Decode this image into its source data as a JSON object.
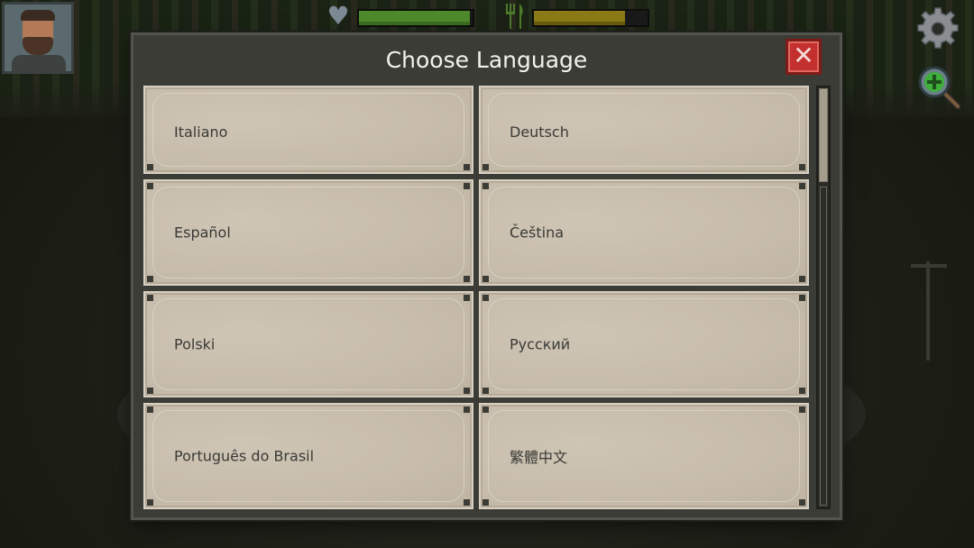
{
  "dialog": {
    "title": "Choose Language",
    "close_label": "✕"
  },
  "languages": [
    {
      "label": "Italiano"
    },
    {
      "label": "Deutsch"
    },
    {
      "label": "Español"
    },
    {
      "label": "Čeština"
    },
    {
      "label": "Polski"
    },
    {
      "label": "Русский"
    },
    {
      "label": "Português do Brasil"
    },
    {
      "label": "繁體中文"
    }
  ],
  "hud": {
    "health_level": 0.98,
    "food_level": 0.8,
    "health_color": "#4e8a2c",
    "food_color": "#8c7a16",
    "icons": [
      "heart-icon",
      "fork-icon",
      "gear-icon",
      "zoom-in-icon",
      "avatar"
    ]
  },
  "colors": {
    "close_button": "#c3302e",
    "panel": "#3b3c36",
    "button_parchment": "#c9bfae"
  }
}
